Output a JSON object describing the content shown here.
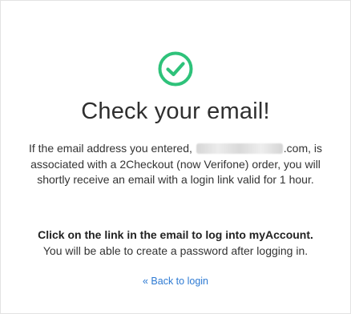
{
  "icon": {
    "name": "check-circle-icon",
    "color": "#2ec27a"
  },
  "title": "Check your email!",
  "description": {
    "before_email": "If the email address you entered, ",
    "email_suffix": ".com,",
    "after_email": " is associated with a 2Checkout (now Verifone) order, you will shortly receive an email with a login link valid for 1 hour."
  },
  "instruction": {
    "bold": "Click on the link in the email to log into myAccount.",
    "normal": "You will be able to create a password after logging in."
  },
  "back_link": "« Back to login",
  "colors": {
    "link": "#2d7ad3",
    "success": "#2ec27a"
  }
}
